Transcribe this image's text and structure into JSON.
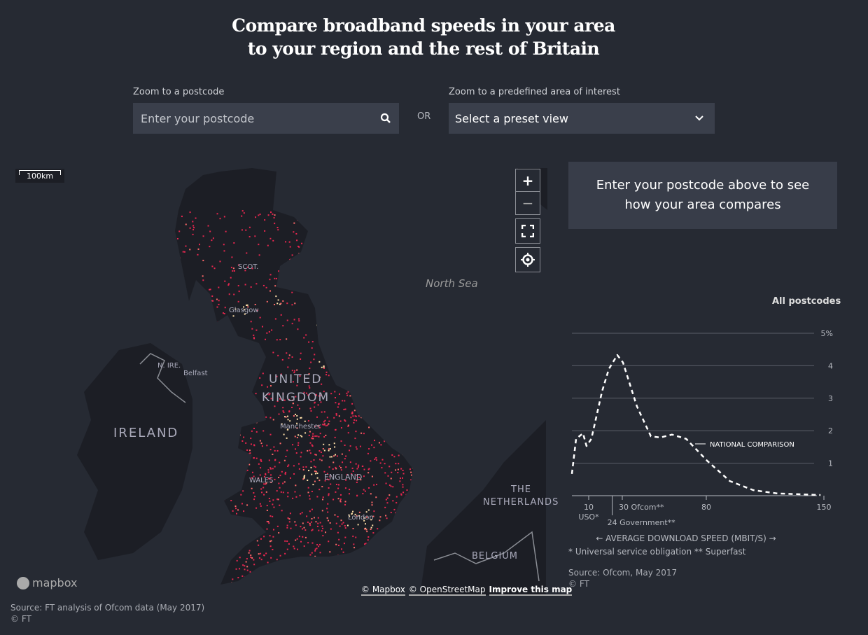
{
  "title": [
    "Compare broadband speeds in your area",
    "to your region and the rest of Britain"
  ],
  "postcode": {
    "label": "Zoom to a postcode",
    "placeholder": "Enter your postcode",
    "icon": "search-icon"
  },
  "or": "OR",
  "preset": {
    "label": "Zoom to a predefined area of interest",
    "value": "Select a preset view",
    "icon": "chevron-down-icon"
  },
  "map": {
    "scale": "100km",
    "labels": {
      "scot": "SCOT.",
      "glasgow": "Glasgow",
      "nire": "N. IRE.",
      "belfast": "Belfast",
      "uk1": "UNITED",
      "uk2": "KINGDOM",
      "manchester": "Manchester",
      "ireland": "IRELAND",
      "wales": "WALES",
      "england": "ENGLAND",
      "london": "London",
      "northsea": "North Sea",
      "neth1": "THE",
      "neth2": "NETHERLANDS",
      "belgium": "BELGIUM"
    },
    "controls": {
      "zoom_in": "+",
      "zoom_out": "−"
    },
    "logo": "mapbox",
    "attribution": [
      "© Mapbox",
      "© OpenStreetMap",
      "Improve this map"
    ],
    "colors": {
      "land": "#1c1e25",
      "sea": "#262a33",
      "low": "#e8264f",
      "mid": "#ff6a6a",
      "high": "#ffe0a8"
    }
  },
  "source_left": [
    "Source: FT analysis of Ofcom data (May 2017)",
    "© FT"
  ],
  "prompt": "Enter your postcode above to see how your area compares",
  "chart_data": {
    "type": "line",
    "title": "All postcodes",
    "xlabel": "← AVERAGE DOWNLOAD SPEED (MBIT/S) →",
    "xlim": [
      0,
      150
    ],
    "ylim": [
      0,
      5
    ],
    "yticks": [
      {
        "v": 1,
        "l": "1"
      },
      {
        "v": 2,
        "l": "2"
      },
      {
        "v": 3,
        "l": "3"
      },
      {
        "v": 4,
        "l": "4"
      },
      {
        "v": 5,
        "l": "5%"
      }
    ],
    "xticks": [
      {
        "v": 10,
        "l": "10",
        "sub": "USO*"
      },
      {
        "v": 30,
        "l": "30 Ofcom**"
      },
      {
        "v": 80,
        "l": "80"
      },
      {
        "v": 150,
        "l": "150"
      }
    ],
    "marker": {
      "v": 24,
      "l": "24 Government**"
    },
    "grid": true,
    "series": [
      {
        "name": "NATIONAL COMPARISON",
        "x": [
          0,
          2.5,
          6.6,
          8.7,
          11.6,
          17.9,
          22,
          27,
          30.4,
          38.7,
          47,
          52.5,
          59.6,
          68,
          80.4,
          94,
          108,
          122,
          148
        ],
        "y": [
          0.67,
          1.75,
          1.92,
          1.53,
          1.75,
          3.2,
          3.9,
          4.33,
          4.1,
          2.75,
          1.83,
          1.79,
          1.88,
          1.75,
          1.08,
          0.45,
          0.17,
          0.07,
          0.02
        ]
      }
    ],
    "footnote": "* Universal service obligation ** Superfast",
    "source": [
      "Source: Ofcom, May 2017",
      "© FT"
    ]
  }
}
